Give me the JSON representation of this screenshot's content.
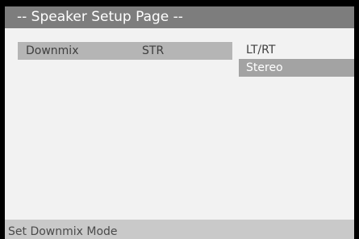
{
  "header": {
    "title": "-- Speaker Setup Page --"
  },
  "setting": {
    "label": "Downmix",
    "value": "STR"
  },
  "options": [
    {
      "label": "LT/RT",
      "selected": false
    },
    {
      "label": "Stereo",
      "selected": true
    }
  ],
  "footer": {
    "hint": "Set Downmix Mode"
  },
  "colors": {
    "header_bg": "#7d7d7d",
    "screen_bg": "#f2f2f2",
    "setting_row_bg": "#b5b5b5",
    "selected_option_bg": "#a3a3a3",
    "footer_bg": "#c9c9c9"
  }
}
